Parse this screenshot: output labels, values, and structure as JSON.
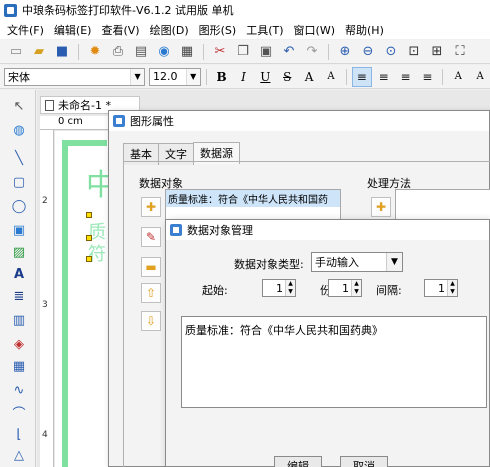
{
  "window": {
    "title": "中琅条码标签打印软件-V6.1.2 试用版 单机"
  },
  "menu": [
    "文件(F)",
    "编辑(E)",
    "查看(V)",
    "绘图(D)",
    "图形(S)",
    "工具(T)",
    "窗口(W)",
    "帮助(H)"
  ],
  "format": {
    "font": "宋体",
    "size": "12.0",
    "bold": "B",
    "italic": "I",
    "underline": "U",
    "strike": "S"
  },
  "document": {
    "tab_title": "未命名-1 *",
    "ruler_unit": "0 cm",
    "ruler_left_numbers": [
      "2",
      "3",
      "4"
    ],
    "canvas_big_text": "中",
    "canvas_faint_text": "质\n符"
  },
  "graphic_props": {
    "title": "图形属性",
    "tabs": [
      "基本",
      "文字",
      "数据源"
    ],
    "data_objects_label": "数据对象",
    "processing_label": "处理方法",
    "list_items": [
      "质量标准：符合《中华人民共和国药"
    ]
  },
  "data_object_mgr": {
    "title": "数据对象管理",
    "type_label": "数据对象类型:",
    "type_value": "手动输入",
    "start_label": "起始:",
    "start_value": "1",
    "copies_label": "份数:",
    "copies_value": "1",
    "interval_label": "间隔:",
    "interval_value": "1",
    "content": "质量标准：符合《中华人民共和国药典》",
    "edit_button": "编辑",
    "cancel_button": "取消"
  }
}
